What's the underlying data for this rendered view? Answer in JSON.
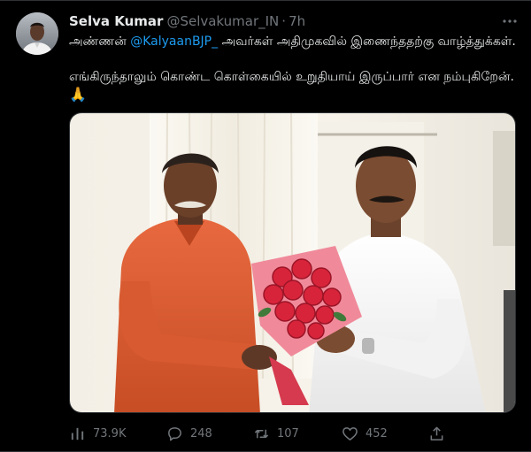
{
  "tweet": {
    "author": {
      "name": "Selva Kumar",
      "handle": "@Selvakumar_IN",
      "separator": "·",
      "time": "7h"
    },
    "text": {
      "line1_prefix": "அண்ணன் ",
      "mention": "@KalyaanBJP_",
      "line1_suffix": " அவர்கள் அதிமுகவில் இணைந்ததற்கு வாழ்த்துக்கள்.",
      "line2": "எங்கிருந்தாலும் கொண்ட கொள்கையில் உறுதியாய் இருப்பார் என நம்புகிறேன்.",
      "emoji": "🙏"
    },
    "stats": {
      "views": "73.9K",
      "replies": "248",
      "retweets": "107",
      "likes": "452"
    }
  },
  "icons": {
    "more": "more-horizontal-icon",
    "views": "analytics-icon",
    "reply": "reply-icon",
    "retweet": "retweet-icon",
    "like": "heart-icon",
    "share": "share-icon"
  },
  "colors": {
    "background": "#000000",
    "text": "#e7e9ea",
    "secondary": "#71767b",
    "link": "#1d9bf0"
  }
}
